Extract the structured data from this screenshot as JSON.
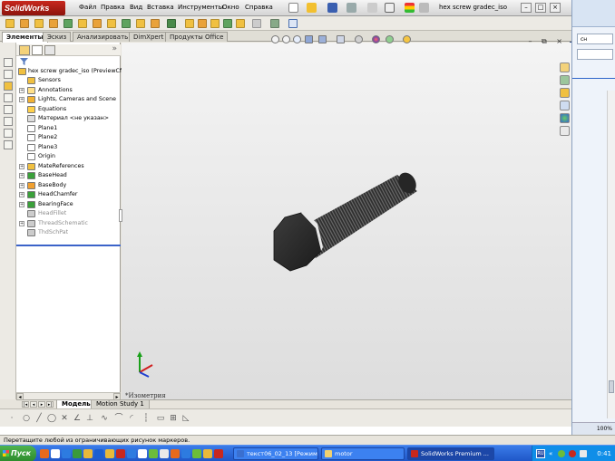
{
  "window": {
    "brand": "SolidWorks",
    "menus": [
      "Файл",
      "Правка",
      "Вид",
      "Вставка",
      "Инструменты",
      "Окно",
      "Справка"
    ],
    "doc_title": "hex screw gradec_iso"
  },
  "command_tabs": [
    "Элементы",
    "Эскиз",
    "Анализировать",
    "DimXpert",
    "Продукты Office"
  ],
  "feature_tree": {
    "root": "hex screw gradec_iso  (PreviewCfg",
    "items": [
      {
        "label": "Sensors",
        "expand": false,
        "gray": false,
        "icon": "sensors-icon",
        "color": "#f0c040"
      },
      {
        "label": "Annotations",
        "expand": true,
        "gray": false,
        "icon": "annotations-icon",
        "color": "#ffe08a"
      },
      {
        "label": "Lights, Cameras and Scene",
        "expand": true,
        "gray": false,
        "icon": "lights-icon",
        "color": "#f2b233"
      },
      {
        "label": "Equations",
        "expand": false,
        "gray": false,
        "icon": "equations-icon",
        "color": "#ffd04a"
      },
      {
        "label": "Материал <не указан>",
        "expand": false,
        "gray": false,
        "icon": "material-icon",
        "color": "#dddddd"
      },
      {
        "label": "Plane1",
        "expand": false,
        "gray": false,
        "icon": "plane-icon",
        "color": "#ffffff"
      },
      {
        "label": "Plane2",
        "expand": false,
        "gray": false,
        "icon": "plane-icon",
        "color": "#ffffff"
      },
      {
        "label": "Plane3",
        "expand": false,
        "gray": false,
        "icon": "plane-icon",
        "color": "#ffffff"
      },
      {
        "label": "Origin",
        "expand": false,
        "gray": false,
        "icon": "origin-icon",
        "color": "#ffffff"
      },
      {
        "label": "MateReferences",
        "expand": true,
        "gray": false,
        "icon": "mate-references-icon",
        "color": "#f0c040"
      },
      {
        "label": "BaseHead",
        "expand": true,
        "gray": false,
        "icon": "feature-icon",
        "color": "#3aa03a"
      },
      {
        "label": "BaseBody",
        "expand": true,
        "gray": false,
        "icon": "feature-icon",
        "color": "#f0a030"
      },
      {
        "label": "HeadChamfer",
        "expand": true,
        "gray": false,
        "icon": "feature-icon",
        "color": "#3aa03a"
      },
      {
        "label": "BearingFace",
        "expand": true,
        "gray": false,
        "icon": "feature-icon",
        "color": "#3aa03a"
      },
      {
        "label": "HeadFillet",
        "expand": false,
        "gray": true,
        "icon": "fillet-icon",
        "color": "#cccccc"
      },
      {
        "label": "ThreadSchematic",
        "expand": true,
        "gray": true,
        "icon": "thread-icon",
        "color": "#cccccc"
      },
      {
        "label": "ThdSchPat",
        "expand": false,
        "gray": true,
        "icon": "pattern-icon",
        "color": "#cccccc"
      }
    ]
  },
  "bottom_tabs": [
    "Модель",
    "Motion Study 1"
  ],
  "view_label": "*Изометрия",
  "status_text": "Перетащите любой из ограничивающих рисунок маркеров.",
  "background_window": {
    "field": "сн",
    "zoom": "100%"
  },
  "taskbar": {
    "start": "Пуск",
    "tasks": [
      {
        "label": "текст06_02_13 [Режим ...",
        "active": false
      },
      {
        "label": "motor",
        "active": false
      },
      {
        "label": "SolidWorks Premium ...",
        "active": true
      }
    ],
    "lang": "RU",
    "clock": "0:41"
  }
}
